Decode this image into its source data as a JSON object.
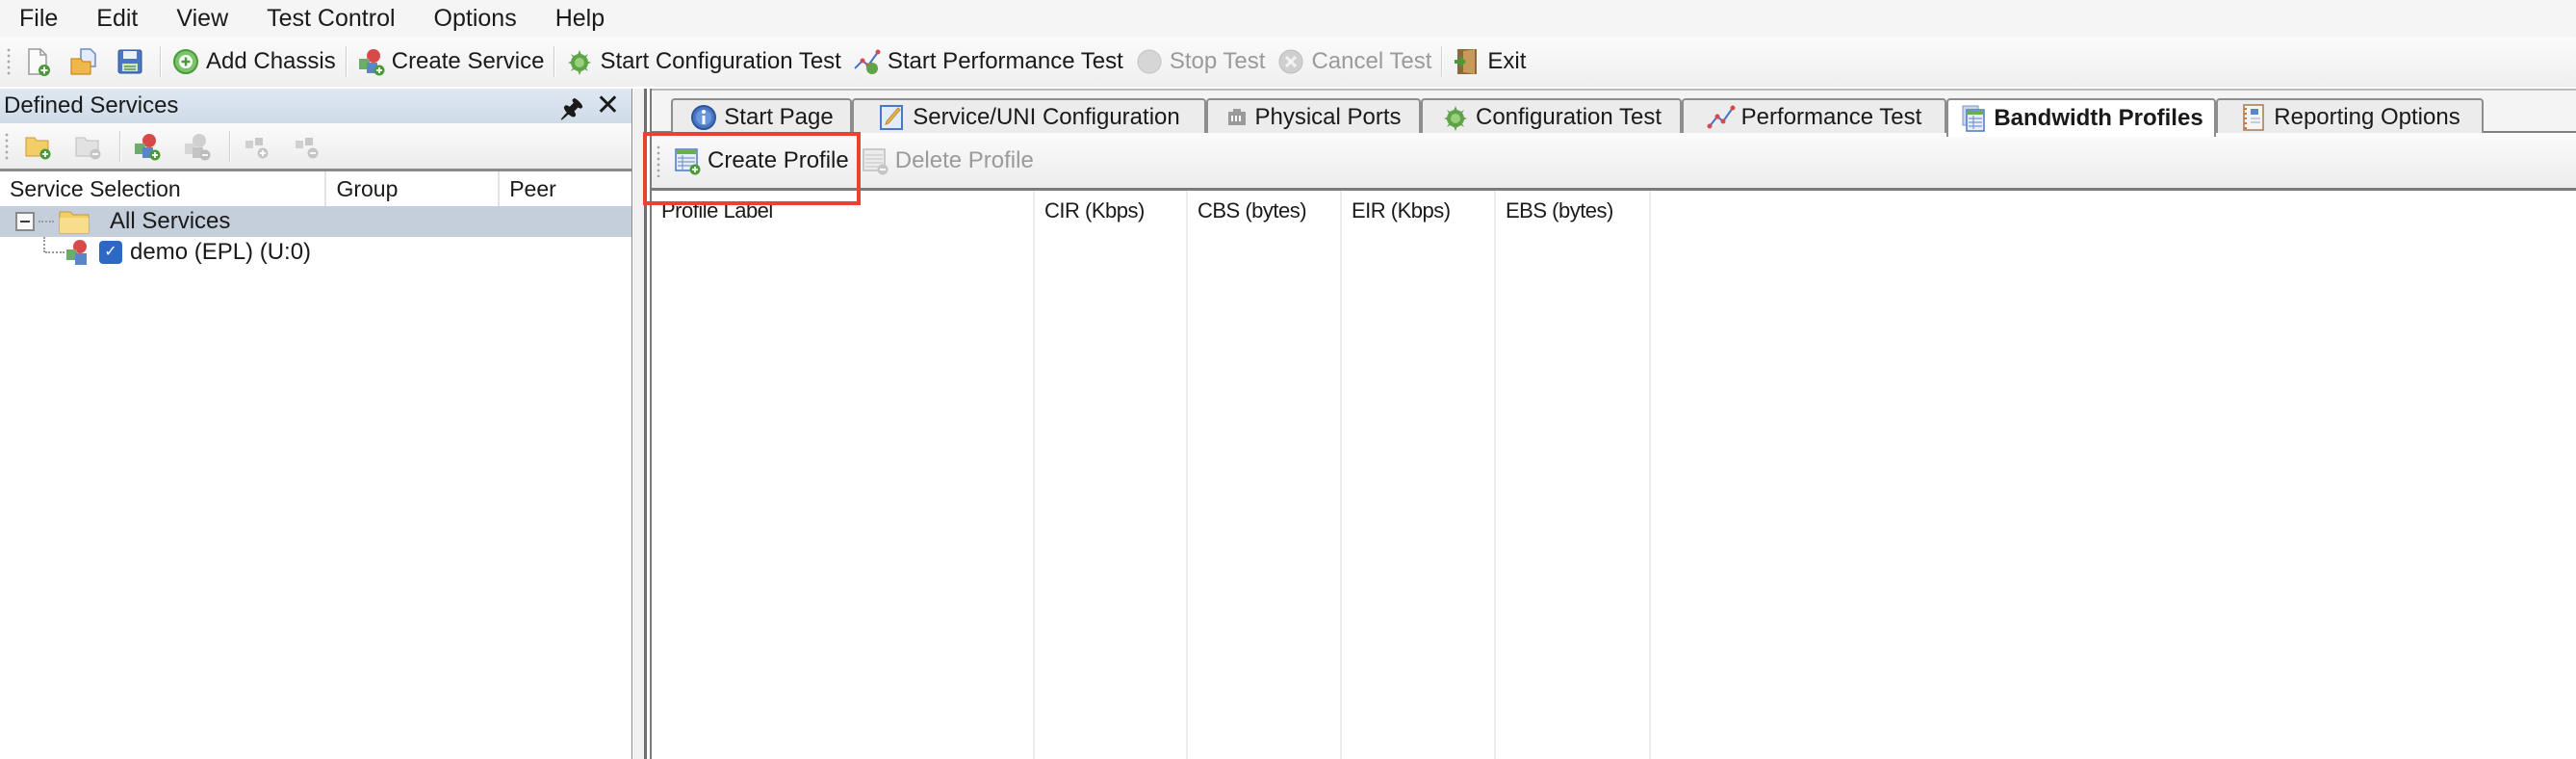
{
  "menu": {
    "items": [
      "File",
      "Edit",
      "View",
      "Test Control",
      "Options",
      "Help"
    ]
  },
  "toolbar": {
    "new_icon": "new-document-icon",
    "open_icon": "open-folder-icon",
    "save_icon": "save-disk-icon",
    "add_chassis": "Add Chassis",
    "create_service": "Create Service",
    "start_configuration_test": "Start Configuration Test",
    "start_performance_test": "Start Performance Test",
    "stop_test": "Stop Test",
    "cancel_test": "Cancel Test",
    "exit": "Exit"
  },
  "left_panel": {
    "title": "Defined Services",
    "pin_glyph": "ф",
    "close_glyph": "✕",
    "columns": [
      "Service Selection",
      "Group",
      "Peer"
    ],
    "tree": {
      "root": {
        "label": "All Services",
        "expanded": true,
        "selected": true
      },
      "children": [
        {
          "label": "demo (EPL) (U:0)",
          "checked": true
        }
      ]
    }
  },
  "tabs": [
    {
      "label": "Start Page",
      "icon": "info-icon",
      "active": false
    },
    {
      "label": "Service/UNI Configuration",
      "icon": "edit-pencil-icon",
      "active": false
    },
    {
      "label": "Physical Ports",
      "icon": "port-icon",
      "active": false
    },
    {
      "label": "Configuration Test",
      "icon": "bug-gear-icon",
      "active": false
    },
    {
      "label": "Performance Test",
      "icon": "line-graph-icon",
      "active": false
    },
    {
      "label": "Bandwidth Profiles",
      "icon": "table-stack-icon",
      "active": true
    },
    {
      "label": "Reporting Options",
      "icon": "notebook-icon",
      "active": false
    }
  ],
  "bandwidth_profiles": {
    "toolbar": {
      "create_profile": "Create Profile",
      "delete_profile": "Delete Profile"
    },
    "columns": [
      "Profile Label",
      "CIR (Kbps)",
      "CBS (bytes)",
      "EIR (Kbps)",
      "EBS (bytes)"
    ],
    "rows": []
  },
  "colors": {
    "highlight": "#e8432e",
    "selected_row": "#c5cedb",
    "panel_header": "#d6e0ec"
  }
}
